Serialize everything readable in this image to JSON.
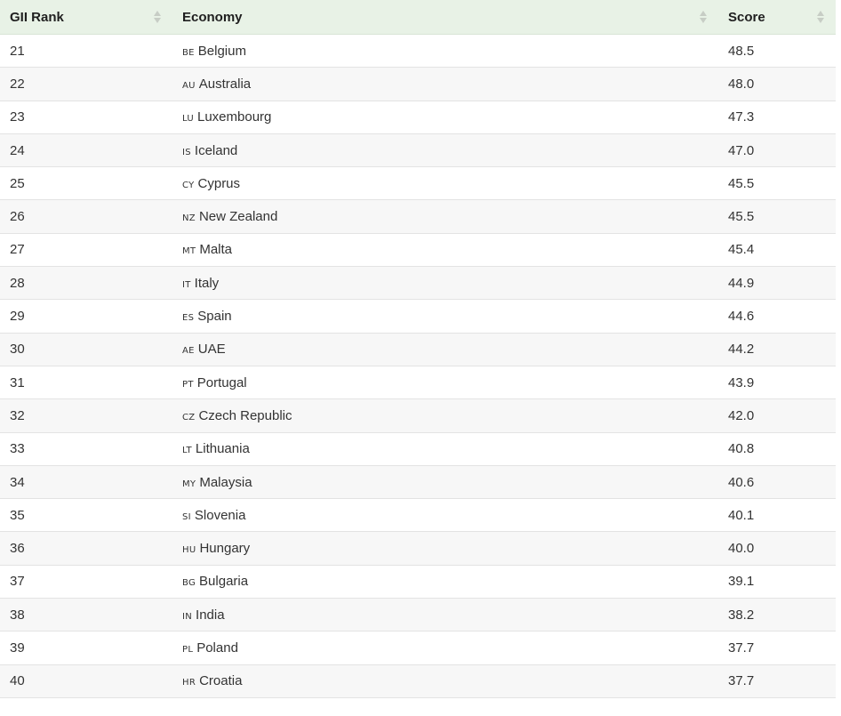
{
  "table": {
    "columns": {
      "rank": "GII Rank",
      "economy": "Economy",
      "score": "Score"
    },
    "rows": [
      {
        "rank": "21",
        "code": "BE",
        "economy": "Belgium",
        "score": "48.5"
      },
      {
        "rank": "22",
        "code": "AU",
        "economy": "Australia",
        "score": "48.0"
      },
      {
        "rank": "23",
        "code": "LU",
        "economy": "Luxembourg",
        "score": "47.3"
      },
      {
        "rank": "24",
        "code": "IS",
        "economy": "Iceland",
        "score": "47.0"
      },
      {
        "rank": "25",
        "code": "CY",
        "economy": "Cyprus",
        "score": "45.5"
      },
      {
        "rank": "26",
        "code": "NZ",
        "economy": "New Zealand",
        "score": "45.5"
      },
      {
        "rank": "27",
        "code": "MT",
        "economy": "Malta",
        "score": "45.4"
      },
      {
        "rank": "28",
        "code": "IT",
        "economy": "Italy",
        "score": "44.9"
      },
      {
        "rank": "29",
        "code": "ES",
        "economy": "Spain",
        "score": "44.6"
      },
      {
        "rank": "30",
        "code": "AE",
        "economy": "UAE",
        "score": "44.2"
      },
      {
        "rank": "31",
        "code": "PT",
        "economy": "Portugal",
        "score": "43.9"
      },
      {
        "rank": "32",
        "code": "CZ",
        "economy": "Czech Republic",
        "score": "42.0"
      },
      {
        "rank": "33",
        "code": "LT",
        "economy": "Lithuania",
        "score": "40.8"
      },
      {
        "rank": "34",
        "code": "MY",
        "economy": "Malaysia",
        "score": "40.6"
      },
      {
        "rank": "35",
        "code": "SI",
        "economy": "Slovenia",
        "score": "40.1"
      },
      {
        "rank": "36",
        "code": "HU",
        "economy": "Hungary",
        "score": "40.0"
      },
      {
        "rank": "37",
        "code": "BG",
        "economy": "Bulgaria",
        "score": "39.1"
      },
      {
        "rank": "38",
        "code": "IN",
        "economy": "India",
        "score": "38.2"
      },
      {
        "rank": "39",
        "code": "PL",
        "economy": "Poland",
        "score": "37.7"
      },
      {
        "rank": "40",
        "code": "HR",
        "economy": "Croatia",
        "score": "37.7"
      }
    ]
  },
  "icons": {
    "sort": "sort-icon"
  },
  "colors": {
    "header_bg": "#e8f2e6",
    "row_alt_bg": "#f7f7f7",
    "sort_arrow": "#c7cdc5"
  }
}
